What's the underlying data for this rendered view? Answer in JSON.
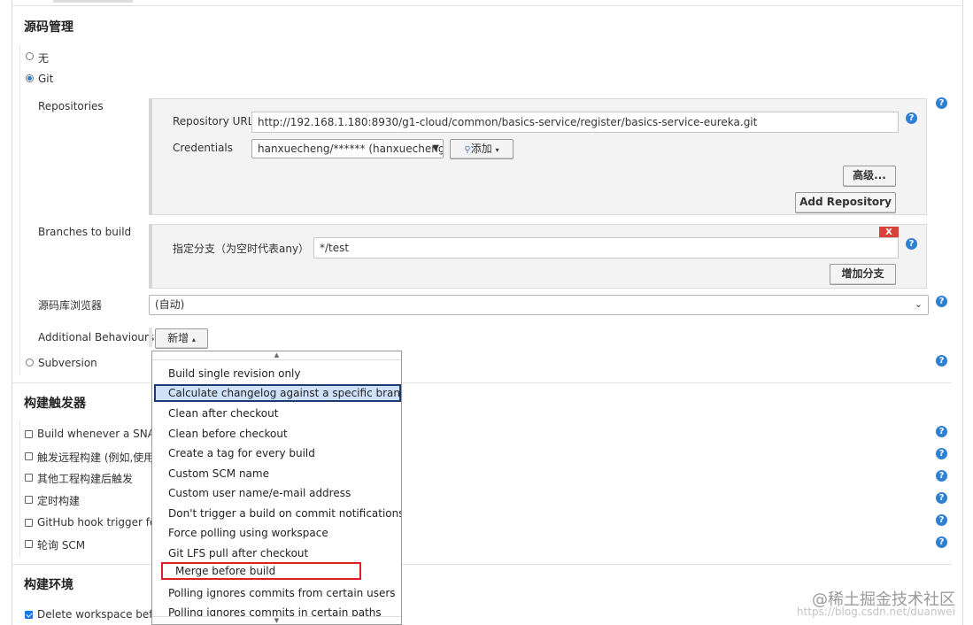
{
  "scm": {
    "section_title": "源码管理",
    "options": {
      "none": "无",
      "git": "Git",
      "subversion": "Subversion"
    },
    "repositories_label": "Repositories",
    "repository_url_label": "Repository URL",
    "repository_url_value": "http://192.168.1.180:8930/g1-cloud/common/basics-service/register/basics-service-eureka.git",
    "credentials_label": "Credentials",
    "credentials_value": "hanxuecheng/****** (hanxuecheng)",
    "add_button": "添加",
    "advanced_button": "高级...",
    "add_repository_button": "Add Repository",
    "branches_label": "Branches to build",
    "branch_specifier_label": "指定分支（为空时代表any）",
    "branch_value": "*/test",
    "delete_branch": "X",
    "add_branch_button": "增加分支",
    "repo_browser_label": "源码库浏览器",
    "repo_browser_value": "(自动)",
    "additional_behaviours_label": "Additional Behaviours",
    "new_button": "新增"
  },
  "behaviours_menu": {
    "items": [
      "Build single revision only",
      "Calculate changelog against a specific branch",
      "Clean after checkout",
      "Clean before checkout",
      "Create a tag for every build",
      "Custom SCM name",
      "Custom user name/e-mail address",
      "Don't trigger a build on commit notifications",
      "Force polling using workspace",
      "Git LFS pull after checkout",
      "Merge before build",
      "Polling ignores commits from certain users",
      "Polling ignores commits in certain paths"
    ],
    "highlighted_item": "Calculate changelog against a specific branch",
    "boxed_item": "Merge before build"
  },
  "triggers": {
    "section_title": "构建触发器",
    "items": [
      "Build whenever a SNAPS",
      "触发远程构建 (例如,使用",
      "其他工程构建后触发",
      "定时构建",
      "GitHub hook trigger for",
      "轮询 SCM"
    ]
  },
  "build_env": {
    "section_title": "构建环境",
    "items": [
      "Delete workspace before"
    ]
  },
  "watermark": {
    "main": "@稀土掘金技术社区",
    "sub": "https://blog.csdn.net/duanwei"
  },
  "help_symbol": "?"
}
